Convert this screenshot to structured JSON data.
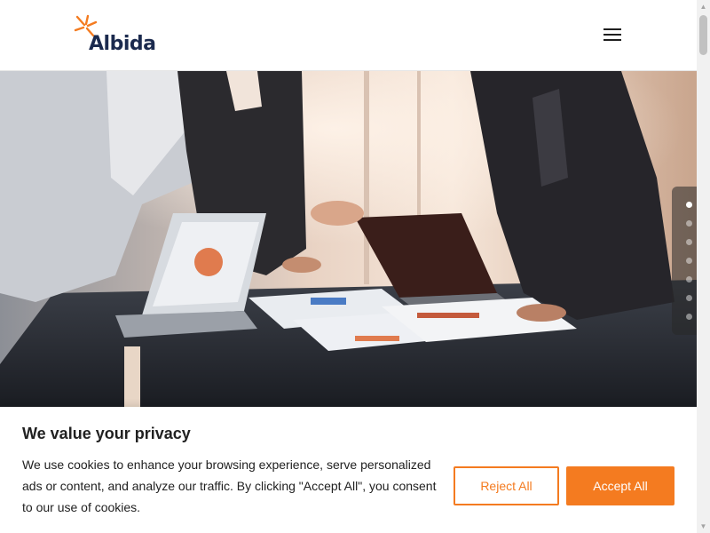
{
  "header": {
    "logo_text": "Albida",
    "menu_icon": "hamburger-menu-icon"
  },
  "hero": {
    "image": "business people meeting around table with laptops and charts",
    "slide_count": 7,
    "active_slide": 1
  },
  "cookie_banner": {
    "title": "We value your privacy",
    "text": "We use cookies to enhance your browsing experience, serve personalized ads or content, and analyze our traffic. By clicking \"Accept All\", you consent to our use of cookies.",
    "reject_label": "Reject All",
    "accept_label": "Accept All"
  },
  "colors": {
    "brand_orange": "#f47b20",
    "brand_navy": "#1b2a4e"
  }
}
